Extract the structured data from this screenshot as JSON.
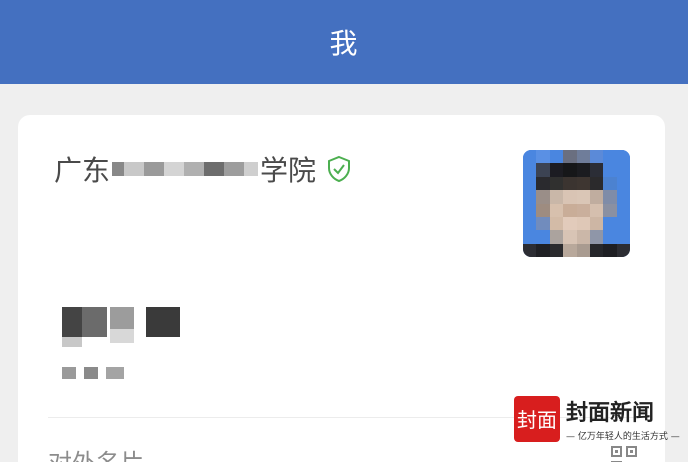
{
  "header": {
    "title": "我"
  },
  "profile": {
    "school_prefix": "广东",
    "school_suffix": "学院",
    "verified_icon": "shield-check-icon",
    "avatar_icon": "avatar-photo"
  },
  "card": {
    "label": "对外名片",
    "qr_icon": "qr-code-icon"
  },
  "watermark": {
    "brand": "封面新闻",
    "logo_text": "封面",
    "slogan": "— 亿万年轻人的生活方式 —"
  },
  "colors": {
    "header_bg": "#4470c0",
    "verified": "#4caf50",
    "watermark_red": "#d81e1e"
  }
}
